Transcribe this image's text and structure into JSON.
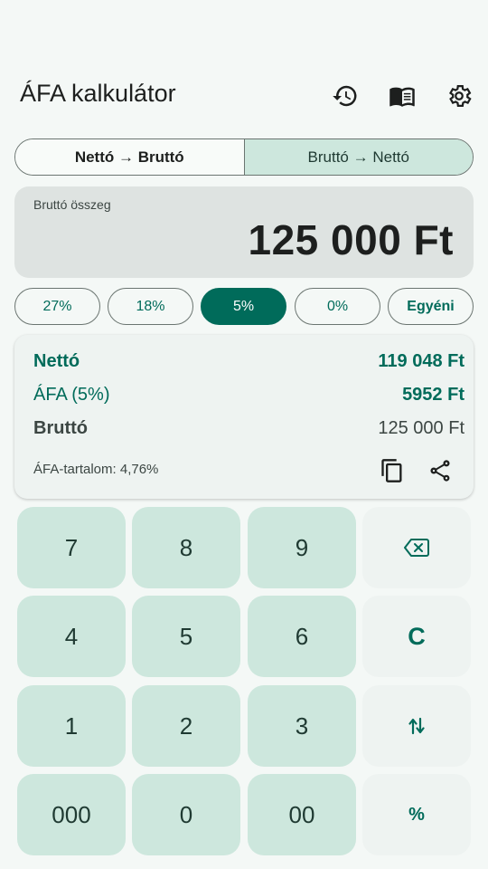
{
  "app_bar": {
    "title": "ÁFA kalkulátor",
    "icons": [
      "history-icon",
      "book-icon",
      "settings-icon"
    ]
  },
  "mode_toggle": {
    "left_label": "Nettó → Bruttó",
    "right_label": "Bruttó → Nettó",
    "selected": "right"
  },
  "input": {
    "label": "Bruttó összeg",
    "value": "125 000 Ft"
  },
  "vat_rates": [
    {
      "label": "27%"
    },
    {
      "label": "18%"
    },
    {
      "label": "5%"
    },
    {
      "label": "0%"
    },
    {
      "label": "Egyéni"
    }
  ],
  "selected_rate": "5%",
  "results": {
    "net_label": "Nettó",
    "net_value": "119 048 Ft",
    "vat_label": "ÁFA (5%)",
    "vat_value": "5952 Ft",
    "gross_label": "Bruttó",
    "gross_value": "125 000 Ft",
    "vat_content": "ÁFA-tartalom: 4,76%"
  },
  "keypad": {
    "k7": "7",
    "k8": "8",
    "k9": "9",
    "k4": "4",
    "k5": "5",
    "k6": "6",
    "k1": "1",
    "k2": "2",
    "k3": "3",
    "k000": "000",
    "k0": "0",
    "k00": "00",
    "clear": "C",
    "percent": "%"
  },
  "colors": {
    "primary": "#006b5a",
    "key_bg": "#cde7dd",
    "background": "#f4f8f6"
  }
}
